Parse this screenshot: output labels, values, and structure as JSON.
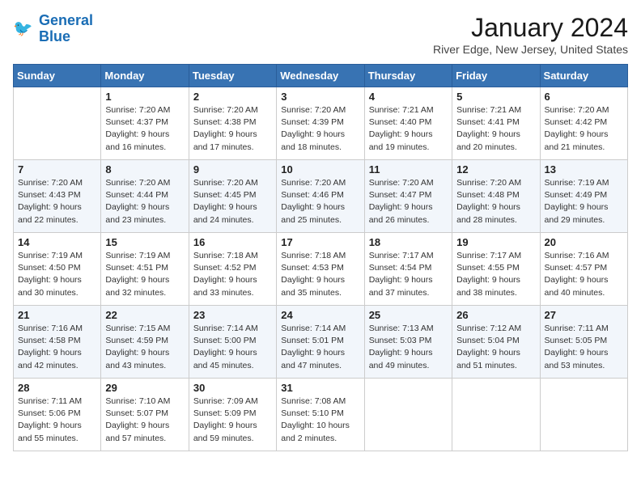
{
  "header": {
    "logo_line1": "General",
    "logo_line2": "Blue",
    "title": "January 2024",
    "subtitle": "River Edge, New Jersey, United States"
  },
  "days_of_week": [
    "Sunday",
    "Monday",
    "Tuesday",
    "Wednesday",
    "Thursday",
    "Friday",
    "Saturday"
  ],
  "weeks": [
    [
      {
        "date": "",
        "info": ""
      },
      {
        "date": "1",
        "info": "Sunrise: 7:20 AM\nSunset: 4:37 PM\nDaylight: 9 hours\nand 16 minutes."
      },
      {
        "date": "2",
        "info": "Sunrise: 7:20 AM\nSunset: 4:38 PM\nDaylight: 9 hours\nand 17 minutes."
      },
      {
        "date": "3",
        "info": "Sunrise: 7:20 AM\nSunset: 4:39 PM\nDaylight: 9 hours\nand 18 minutes."
      },
      {
        "date": "4",
        "info": "Sunrise: 7:21 AM\nSunset: 4:40 PM\nDaylight: 9 hours\nand 19 minutes."
      },
      {
        "date": "5",
        "info": "Sunrise: 7:21 AM\nSunset: 4:41 PM\nDaylight: 9 hours\nand 20 minutes."
      },
      {
        "date": "6",
        "info": "Sunrise: 7:20 AM\nSunset: 4:42 PM\nDaylight: 9 hours\nand 21 minutes."
      }
    ],
    [
      {
        "date": "7",
        "info": "Sunrise: 7:20 AM\nSunset: 4:43 PM\nDaylight: 9 hours\nand 22 minutes."
      },
      {
        "date": "8",
        "info": "Sunrise: 7:20 AM\nSunset: 4:44 PM\nDaylight: 9 hours\nand 23 minutes."
      },
      {
        "date": "9",
        "info": "Sunrise: 7:20 AM\nSunset: 4:45 PM\nDaylight: 9 hours\nand 24 minutes."
      },
      {
        "date": "10",
        "info": "Sunrise: 7:20 AM\nSunset: 4:46 PM\nDaylight: 9 hours\nand 25 minutes."
      },
      {
        "date": "11",
        "info": "Sunrise: 7:20 AM\nSunset: 4:47 PM\nDaylight: 9 hours\nand 26 minutes."
      },
      {
        "date": "12",
        "info": "Sunrise: 7:20 AM\nSunset: 4:48 PM\nDaylight: 9 hours\nand 28 minutes."
      },
      {
        "date": "13",
        "info": "Sunrise: 7:19 AM\nSunset: 4:49 PM\nDaylight: 9 hours\nand 29 minutes."
      }
    ],
    [
      {
        "date": "14",
        "info": "Sunrise: 7:19 AM\nSunset: 4:50 PM\nDaylight: 9 hours\nand 30 minutes."
      },
      {
        "date": "15",
        "info": "Sunrise: 7:19 AM\nSunset: 4:51 PM\nDaylight: 9 hours\nand 32 minutes."
      },
      {
        "date": "16",
        "info": "Sunrise: 7:18 AM\nSunset: 4:52 PM\nDaylight: 9 hours\nand 33 minutes."
      },
      {
        "date": "17",
        "info": "Sunrise: 7:18 AM\nSunset: 4:53 PM\nDaylight: 9 hours\nand 35 minutes."
      },
      {
        "date": "18",
        "info": "Sunrise: 7:17 AM\nSunset: 4:54 PM\nDaylight: 9 hours\nand 37 minutes."
      },
      {
        "date": "19",
        "info": "Sunrise: 7:17 AM\nSunset: 4:55 PM\nDaylight: 9 hours\nand 38 minutes."
      },
      {
        "date": "20",
        "info": "Sunrise: 7:16 AM\nSunset: 4:57 PM\nDaylight: 9 hours\nand 40 minutes."
      }
    ],
    [
      {
        "date": "21",
        "info": "Sunrise: 7:16 AM\nSunset: 4:58 PM\nDaylight: 9 hours\nand 42 minutes."
      },
      {
        "date": "22",
        "info": "Sunrise: 7:15 AM\nSunset: 4:59 PM\nDaylight: 9 hours\nand 43 minutes."
      },
      {
        "date": "23",
        "info": "Sunrise: 7:14 AM\nSunset: 5:00 PM\nDaylight: 9 hours\nand 45 minutes."
      },
      {
        "date": "24",
        "info": "Sunrise: 7:14 AM\nSunset: 5:01 PM\nDaylight: 9 hours\nand 47 minutes."
      },
      {
        "date": "25",
        "info": "Sunrise: 7:13 AM\nSunset: 5:03 PM\nDaylight: 9 hours\nand 49 minutes."
      },
      {
        "date": "26",
        "info": "Sunrise: 7:12 AM\nSunset: 5:04 PM\nDaylight: 9 hours\nand 51 minutes."
      },
      {
        "date": "27",
        "info": "Sunrise: 7:11 AM\nSunset: 5:05 PM\nDaylight: 9 hours\nand 53 minutes."
      }
    ],
    [
      {
        "date": "28",
        "info": "Sunrise: 7:11 AM\nSunset: 5:06 PM\nDaylight: 9 hours\nand 55 minutes."
      },
      {
        "date": "29",
        "info": "Sunrise: 7:10 AM\nSunset: 5:07 PM\nDaylight: 9 hours\nand 57 minutes."
      },
      {
        "date": "30",
        "info": "Sunrise: 7:09 AM\nSunset: 5:09 PM\nDaylight: 9 hours\nand 59 minutes."
      },
      {
        "date": "31",
        "info": "Sunrise: 7:08 AM\nSunset: 5:10 PM\nDaylight: 10 hours\nand 2 minutes."
      },
      {
        "date": "",
        "info": ""
      },
      {
        "date": "",
        "info": ""
      },
      {
        "date": "",
        "info": ""
      }
    ]
  ]
}
